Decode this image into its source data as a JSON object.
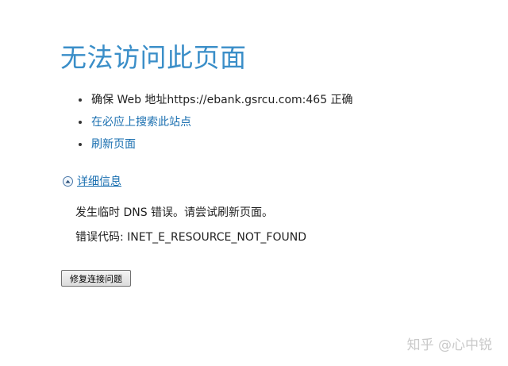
{
  "title": "无法访问此页面",
  "bullets": [
    {
      "text": "确保 Web 地址https://ebank.gsrcu.com:465 正确"
    },
    {
      "text": "在必应上搜索此站点"
    },
    {
      "text": "刷新页面"
    }
  ],
  "details": {
    "toggle_label": "详细信息",
    "message": "发生临时 DNS 错误。请尝试刷新页面。",
    "error_code": "错误代码: INET_E_RESOURCE_NOT_FOUND"
  },
  "fix_button_label": "修复连接问题",
  "watermark": "知乎 @心中锐",
  "colors": {
    "title": "#3a8ec8",
    "link": "#1a6fb0"
  }
}
